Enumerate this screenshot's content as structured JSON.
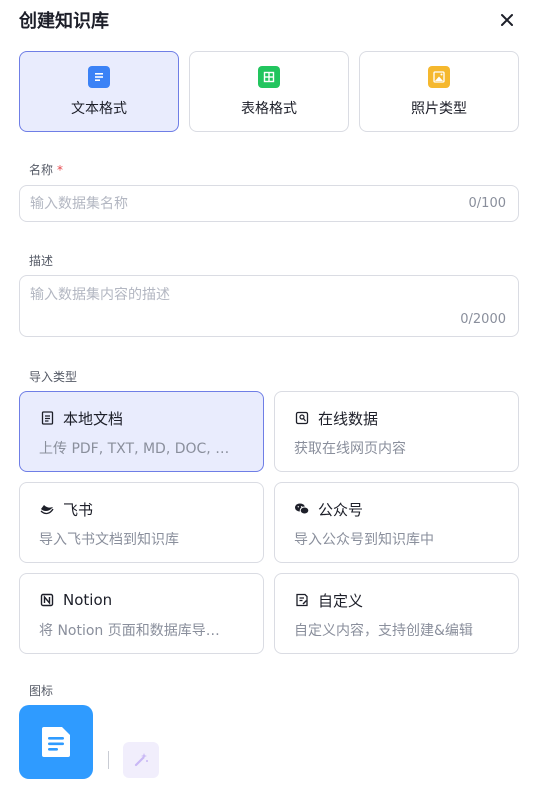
{
  "dialog": {
    "title": "创建知识库"
  },
  "formats": [
    {
      "label": "文本格式",
      "icon": "document-icon",
      "color": "#3b82f6",
      "active": true
    },
    {
      "label": "表格格式",
      "icon": "table-icon",
      "color": "#22c55e",
      "active": false
    },
    {
      "label": "照片类型",
      "icon": "image-icon",
      "color": "#f5b82e",
      "active": false
    }
  ],
  "name_field": {
    "label": "名称",
    "required_mark": "*",
    "placeholder": "输入数据集名称",
    "counter": "0/100"
  },
  "desc_field": {
    "label": "描述",
    "placeholder": "输入数据集内容的描述",
    "counter": "0/2000"
  },
  "import": {
    "label": "导入类型",
    "types": [
      {
        "title": "本地文档",
        "desc": "上传 PDF, TXT, MD, DOC, …",
        "icon": "file-icon",
        "active": true
      },
      {
        "title": "在线数据",
        "desc": "获取在线网页内容",
        "icon": "web-page-icon",
        "active": false
      },
      {
        "title": "飞书",
        "desc": "导入飞书文档到知识库",
        "icon": "feishu-icon",
        "active": false
      },
      {
        "title": "公众号",
        "desc": "导入公众号到知识库中",
        "icon": "wechat-icon",
        "active": false
      },
      {
        "title": "Notion",
        "desc": "将 Notion 页面和数据库导…",
        "icon": "notion-icon",
        "active": false
      },
      {
        "title": "自定义",
        "desc": "自定义内容，支持创建&编辑",
        "icon": "edit-doc-icon",
        "active": false
      }
    ]
  },
  "icon_section": {
    "label": "图标",
    "accent": "#2f9bff"
  }
}
